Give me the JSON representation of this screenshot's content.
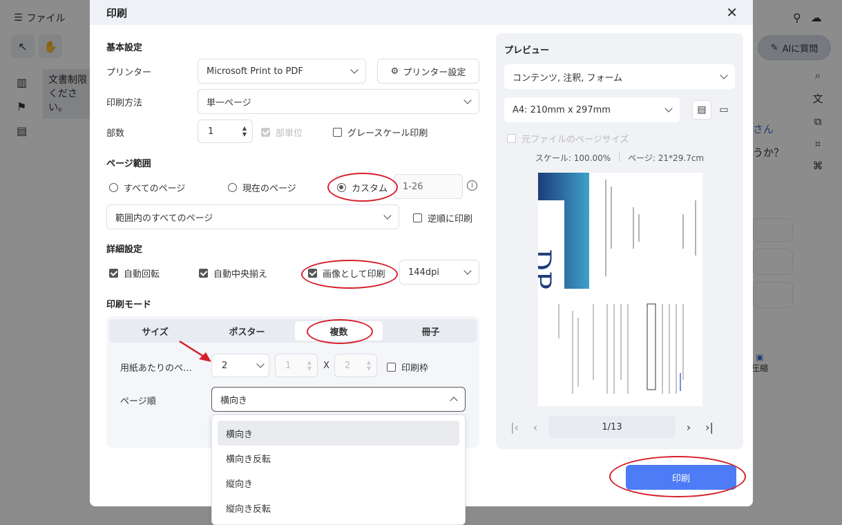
{
  "app": {
    "menu_label": "ファイル",
    "ai_button": "AIに質問",
    "side_text": "文書制限 ください。",
    "right_fragments": [
      "さん",
      "うか？"
    ],
    "compress_label": "圧縮"
  },
  "dialog": {
    "title": "印刷",
    "basic": {
      "section": "基本設定",
      "printer_label": "プリンター",
      "printer_value": "Microsoft Print to PDF",
      "printer_settings": "プリンター設定",
      "method_label": "印刷方法",
      "method_value": "単一ページ",
      "copies_label": "部数",
      "copies_value": "1",
      "collate_label": "部単位",
      "grayscale_label": "グレースケール印刷"
    },
    "range": {
      "section": "ページ範囲",
      "all": "すべてのページ",
      "current": "現在のページ",
      "custom": "カスタム",
      "custom_value": "1-26",
      "subset_value": "範囲内のすべてのページ",
      "reverse": "逆順に印刷"
    },
    "advanced": {
      "section": "詳細設定",
      "auto_rotate": "自動回転",
      "auto_center": "自動中央揃え",
      "print_as_image": "画像として印刷",
      "dpi": "144dpi"
    },
    "mode": {
      "section": "印刷モード",
      "tabs": [
        "サイズ",
        "ポスター",
        "複数",
        "冊子"
      ],
      "active_tab": 2,
      "pages_per_sheet_label": "用紙あたりのペ…",
      "pages_per_sheet": "2",
      "cols": "1",
      "times": "X",
      "rows": "2",
      "border_label": "印刷枠",
      "order_label": "ページ順",
      "order_value": "横向き",
      "order_options": [
        "横向き",
        "横向き反転",
        "縦向き",
        "縦向き反転"
      ]
    },
    "preview": {
      "title": "プレビュー",
      "content_value": "コンテンツ, 注釈, フォーム",
      "paper_value": "A4: 210mm x 297mm",
      "original_size": "元ファイルのページサイズ",
      "scale": "スケール: 100.00%",
      "page_size": "ページ: 21*29.7cm",
      "page_indicator": "1/13"
    },
    "print_button": "印刷"
  },
  "colors": {
    "accent": "#4e7cf6",
    "annotation_red": "#d6202a"
  }
}
